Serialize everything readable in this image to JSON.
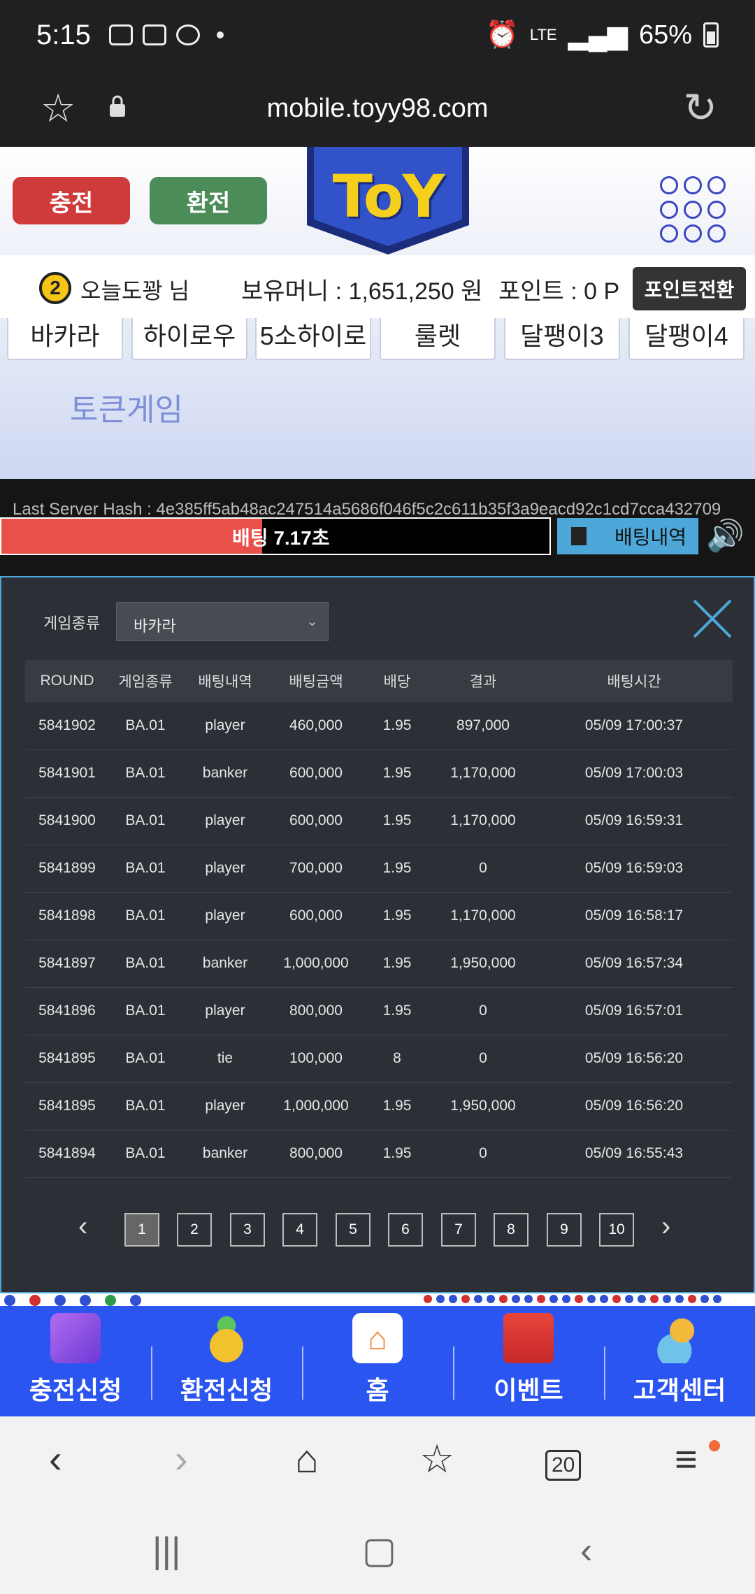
{
  "status_bar": {
    "time": "5:15",
    "network": "LTE",
    "battery": "65%"
  },
  "browser": {
    "url": "mobile.toyy98.com",
    "tabs_count": "20"
  },
  "header": {
    "charge_label": "충전",
    "exchange_label": "환전",
    "logo_text": "ToY"
  },
  "user": {
    "level": "2",
    "name": "오늘도꽝 님",
    "money": "보유머니 : 1,651,250 원",
    "point": "포인트 : 0 P",
    "point_button": "포인트전환"
  },
  "game_tabs": [
    "바카라",
    "하이로우",
    "5소하이로",
    "룰렛",
    "달팽이3",
    "달팽이4"
  ],
  "token_game_label": "토큰게임",
  "server_hash": "Last Server Hash : 4e385ff5ab48ac247514a5686f046f5c2c611b35f3a9eacd92c1cd7cca432709",
  "bet_timer": {
    "label": "배팅",
    "time": "7.17초",
    "progress": 0.476
  },
  "bet_history_button": "배팅내역",
  "modal": {
    "filter_label": "게임종류",
    "filter_value": "바카라",
    "columns": [
      "ROUND",
      "게임종류",
      "배팅내역",
      "배팅금액",
      "배당",
      "결과",
      "배팅시간"
    ],
    "rows": [
      [
        "5841902",
        "BA.01",
        "player",
        "460,000",
        "1.95",
        "897,000",
        "05/09 17:00:37"
      ],
      [
        "5841901",
        "BA.01",
        "banker",
        "600,000",
        "1.95",
        "1,170,000",
        "05/09 17:00:03"
      ],
      [
        "5841900",
        "BA.01",
        "player",
        "600,000",
        "1.95",
        "1,170,000",
        "05/09 16:59:31"
      ],
      [
        "5841899",
        "BA.01",
        "player",
        "700,000",
        "1.95",
        "0",
        "05/09 16:59:03"
      ],
      [
        "5841898",
        "BA.01",
        "player",
        "600,000",
        "1.95",
        "1,170,000",
        "05/09 16:58:17"
      ],
      [
        "5841897",
        "BA.01",
        "banker",
        "1,000,000",
        "1.95",
        "1,950,000",
        "05/09 16:57:34"
      ],
      [
        "5841896",
        "BA.01",
        "player",
        "800,000",
        "1.95",
        "0",
        "05/09 16:57:01"
      ],
      [
        "5841895",
        "BA.01",
        "tie",
        "100,000",
        "8",
        "0",
        "05/09 16:56:20"
      ],
      [
        "5841895",
        "BA.01",
        "player",
        "1,000,000",
        "1.95",
        "1,950,000",
        "05/09 16:56:20"
      ],
      [
        "5841894",
        "BA.01",
        "banker",
        "800,000",
        "1.95",
        "0",
        "05/09 16:55:43"
      ]
    ],
    "pages": [
      "1",
      "2",
      "3",
      "4",
      "5",
      "6",
      "7",
      "8",
      "9",
      "10"
    ],
    "current_page": "1"
  },
  "bottom_nav": [
    {
      "label": "충전신청",
      "icon": "card-icon"
    },
    {
      "label": "환전신청",
      "icon": "coins-icon"
    },
    {
      "label": "홈",
      "icon": "home-icon"
    },
    {
      "label": "이벤트",
      "icon": "gift-icon"
    },
    {
      "label": "고객센터",
      "icon": "support-icon"
    }
  ],
  "colors": {
    "accent_blue": "#2b55f0",
    "charge_red": "#cf3a3a",
    "exchange_green": "#4c8c59",
    "timer_red": "#e9504a",
    "history_blue": "#4da7d8"
  }
}
